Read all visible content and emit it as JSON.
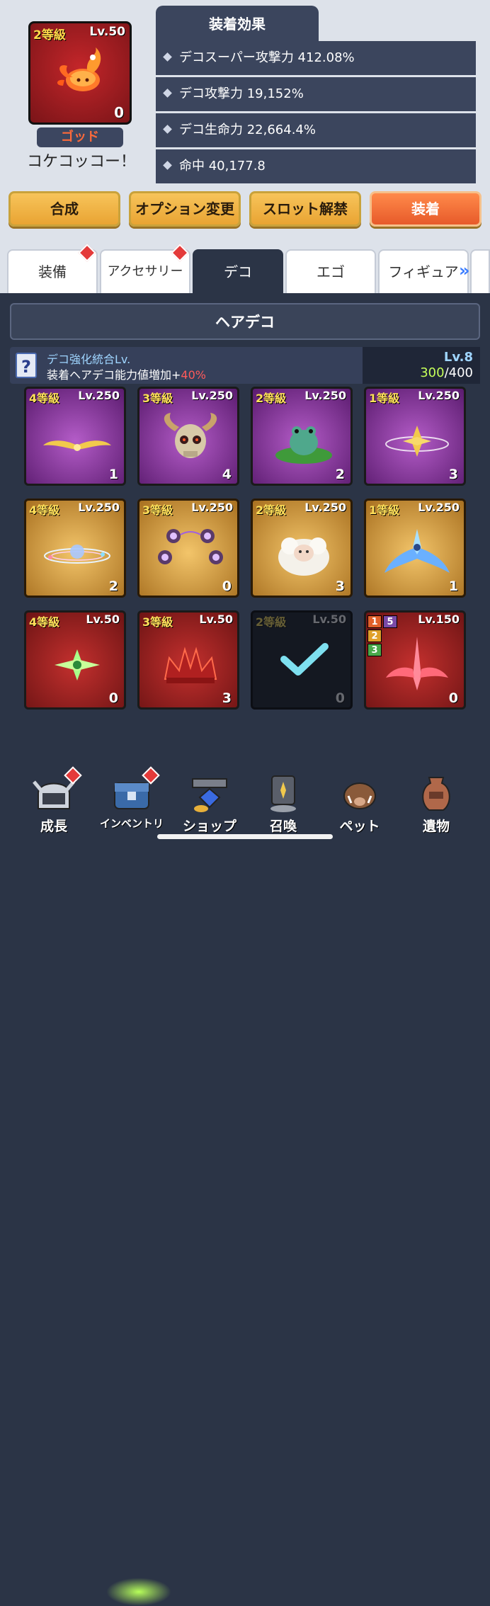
{
  "selected": {
    "grade": "2等級",
    "level": "Lv.50",
    "count": "0",
    "rank": "ゴッド",
    "name": "コケコッコー！"
  },
  "effects": {
    "title": "装着効果",
    "rows": [
      "デコスーパー攻撃力 412.08%",
      "デコ攻撃力 19,152%",
      "デコ生命力 22,664.4%",
      "命中 40,177.8"
    ]
  },
  "buttons": {
    "combine": "合成",
    "option": "オプション変更",
    "slot": "スロット解禁",
    "equip": "装着"
  },
  "tabs": [
    "装備",
    "アクセサリー",
    "デコ",
    "エゴ",
    "フィギュア"
  ],
  "section": "ヘアデコ",
  "info": {
    "title": "デコ強化統合Lv.",
    "desc_prefix": "装着ヘアデコ能力値増加+",
    "desc_value": "40%",
    "level": "Lv.8",
    "current": "300",
    "max": "/400"
  },
  "cards": [
    {
      "grade": "4等級",
      "level": "Lv.250",
      "count": "1",
      "rarity": "purple",
      "icon": "golden-wings-icon"
    },
    {
      "grade": "3等級",
      "level": "Lv.250",
      "count": "4",
      "rarity": "purple",
      "icon": "horned-skull-icon"
    },
    {
      "grade": "2等級",
      "level": "Lv.250",
      "count": "2",
      "rarity": "purple",
      "icon": "frog-lilypad-icon"
    },
    {
      "grade": "1等級",
      "level": "Lv.250",
      "count": "3",
      "rarity": "purple",
      "icon": "star-ring-icon"
    },
    {
      "grade": "4等級",
      "level": "Lv.250",
      "count": "2",
      "rarity": "gold",
      "icon": "orbit-halo-icon"
    },
    {
      "grade": "3等級",
      "level": "Lv.250",
      "count": "0",
      "rarity": "gold",
      "icon": "spirit-orbs-icon"
    },
    {
      "grade": "2等級",
      "level": "Lv.250",
      "count": "3",
      "rarity": "gold",
      "icon": "sheep-icon"
    },
    {
      "grade": "1等級",
      "level": "Lv.250",
      "count": "1",
      "rarity": "gold",
      "icon": "crystal-wings-icon"
    },
    {
      "grade": "4等級",
      "level": "Lv.50",
      "count": "0",
      "rarity": "red",
      "icon": "green-star-icon"
    },
    {
      "grade": "3等級",
      "level": "Lv.50",
      "count": "3",
      "rarity": "red",
      "icon": "red-crown-icon"
    },
    {
      "grade": "2等級",
      "level": "Lv.50",
      "count": "0",
      "rarity": "dark",
      "icon": "check-icon"
    },
    {
      "grade": "",
      "level": "Lv.150",
      "count": "0",
      "rarity": "red",
      "icon": "sword-wings-icon",
      "chips": [
        "1",
        "5",
        "2",
        "3"
      ]
    }
  ],
  "nav": [
    {
      "label": "成長",
      "icon": "helmet-icon",
      "dot": true
    },
    {
      "label": "インベントリ",
      "icon": "chest-icon",
      "dot": true
    },
    {
      "label": "ショップ",
      "icon": "shop-icon",
      "dot": false
    },
    {
      "label": "召喚",
      "icon": "summon-card-icon",
      "dot": false
    },
    {
      "label": "ペット",
      "icon": "boar-icon",
      "dot": false
    },
    {
      "label": "遺物",
      "icon": "vase-icon",
      "dot": false
    }
  ]
}
